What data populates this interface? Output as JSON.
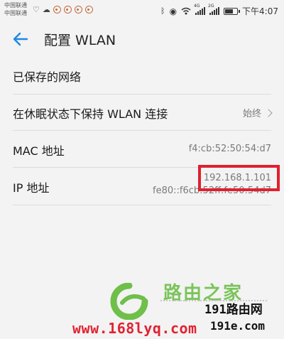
{
  "statusbar": {
    "carrier1": "中国联通",
    "carrier2": "中国联通",
    "net_badges": [
      "4G",
      "2G"
    ],
    "time": "下午4:07"
  },
  "header": {
    "title": "配置 WLAN"
  },
  "settings": {
    "saved_networks": "已保存的网络",
    "sleep_label": "在休眠状态下保持 WLAN 连接",
    "sleep_value": "始终",
    "mac_label": "MAC 地址",
    "mac_value": "f4:cb:52:50:54:d7",
    "ip_label": "IP 地址",
    "ip_v4": "192.168.1.101",
    "ip_v6": "fe80::f6cb:52ff:fe50:54d7"
  },
  "watermark": {
    "site_cn": "路由之家",
    "site_191a": "191路由网",
    "site_191b": "191e.com",
    "url": "www.168lyq.com"
  },
  "colors": {
    "accent": "#1e88e5",
    "highlight": "#e0202e",
    "watermark_green": "#6fbf4a"
  }
}
